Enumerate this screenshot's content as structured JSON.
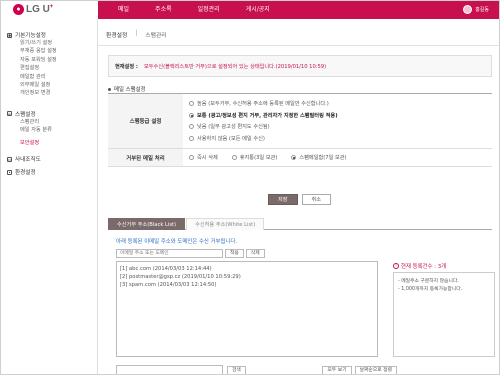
{
  "logo": {
    "mark": "●",
    "text": "LG U",
    "plus": "+"
  },
  "nav": {
    "items": [
      "메일",
      "주소록",
      "일정관리",
      "게시/공지"
    ]
  },
  "user": {
    "name": "홍길동"
  },
  "sidebar": {
    "sections": [
      {
        "icon": "gear-icon",
        "title": "기본기능설정",
        "items": [
          "읽기/쓰기 설정",
          "부재중 응답 설정",
          "자동 포워딩 설정",
          "편집설정",
          "메일함 관리",
          "외부메일 설정",
          "개인정보 변경"
        ],
        "active": -1
      },
      {
        "icon": "shield-icon",
        "title": "스팸설정",
        "items": [
          "스팸관리",
          "메일 자동 분류"
        ],
        "active": -1
      },
      {
        "icon": "lock-icon",
        "title": "",
        "items": [
          "보안설정"
        ],
        "active": 0
      }
    ],
    "bottom": [
      {
        "icon": "org-icon",
        "label": "사내조직도"
      },
      {
        "icon": "settings-icon",
        "label": "환경설정"
      }
    ]
  },
  "breadcrumb": {
    "root": "환경설정",
    "sep": "|",
    "current": "스팸관리"
  },
  "status": {
    "label": "현재설정 :",
    "value": "모두수신(블랙리스트만 거부)으로 설정되어 있는 상태입니다.(2019/01/10 10:59)"
  },
  "mail_settings": {
    "title": "메일 스팸설정",
    "grade_label": "스팸등급 설정",
    "grade_options": [
      {
        "label": "높음 (모두거부, 수신허용 주소에 등록된 메일만 수신합니다.)",
        "checked": false,
        "bold": false
      },
      {
        "label": "보통 (광고/정보성 편지 거부, 관리자가 지정한 스팸필터링 적용)",
        "checked": true,
        "bold": true
      },
      {
        "label": "낮음 (일부 광고성 편지도 수신됨)",
        "checked": false,
        "bold": false
      },
      {
        "label": "사용하지 않음 (모든 메일 수신)",
        "checked": false,
        "bold": false
      }
    ],
    "reject_label": "거부된 메일 처리",
    "reject_options": [
      {
        "label": "즉시 삭제",
        "checked": false
      },
      {
        "label": "휴지통(3일 보관)",
        "checked": false
      },
      {
        "label": "스팸메일함(7일 보관)",
        "checked": true
      }
    ]
  },
  "buttons": {
    "save": "저장",
    "cancel": "취소"
  },
  "tabs": [
    "수신거부 주소(Black List)",
    "수신허용 주소(White List)"
  ],
  "list": {
    "description": "아래 등록된 이메일 주소와 도메인은 수신 거부됩니다.",
    "search_placeholder": "이메일 주소 또는 도메인",
    "register": "적용",
    "delete": "삭제",
    "entries": [
      "[1] abc.com (2014/03/03 12:14:44)",
      "[2] postmaster@gsp.cz (2019/01/10 10:59:29)",
      "[3] spam.com (2014/03/03 12:14:50)"
    ],
    "current_count": "현재 등록건수 : 3개",
    "notes": [
      "- 메일주소 구분하지 않습니다.",
      "- 1,000개까지 등록가능합니다."
    ],
    "search_btn": "검색",
    "view_all": "모두 보기",
    "sort_date": "날짜순으로 정렬"
  },
  "colors": {
    "accent": "#c8104f",
    "tab_active": "#7a6a6a",
    "link": "#2a6fbf"
  }
}
